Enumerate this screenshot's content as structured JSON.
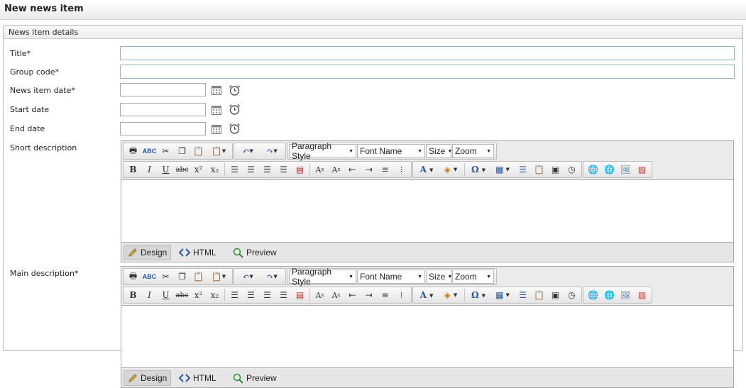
{
  "page": {
    "title": "New news item"
  },
  "section": {
    "legend": "News item details"
  },
  "fields": {
    "title": {
      "label": "Title*",
      "value": ""
    },
    "group_code": {
      "label": "Group code*",
      "value": ""
    },
    "news_item_date": {
      "label": "News item date*",
      "value": "",
      "calendar_icon": "calendar-icon",
      "time_icon": "alarm-clock-icon"
    },
    "start_date": {
      "label": "Start date",
      "value": "",
      "calendar_icon": "calendar-icon",
      "time_icon": "alarm-clock-icon"
    },
    "end_date": {
      "label": "End date",
      "value": "",
      "calendar_icon": "calendar-icon",
      "time_icon": "alarm-clock-icon"
    },
    "short_description": {
      "label": "Short description"
    },
    "main_description": {
      "label": "Main description*"
    }
  },
  "editor": {
    "toolbar_row1": {
      "group1_icons": [
        "print-icon",
        "spellcheck-icon",
        "cut-icon",
        "copy-icon",
        "paste-icon",
        "paste-options-icon"
      ],
      "group2_icons": [
        "undo-icon",
        "redo-icon"
      ],
      "paragraph_style": "Paragraph Style",
      "font_name": "Font Name",
      "size": "Size",
      "zoom": "Zoom"
    },
    "toolbar_row2": {
      "format_buttons": [
        "B",
        "I",
        "U",
        "abc",
        "x²",
        "x₂"
      ],
      "align_icons": [
        "align-left-icon",
        "align-center-icon",
        "align-right-icon",
        "justify-icon",
        "style-icon"
      ],
      "list_icons": [
        "superscript-a-icon",
        "subscript-a-icon",
        "outdent-icon",
        "indent-icon",
        "numbered-list-icon",
        "bulleted-list-icon"
      ],
      "color_labels": [
        "A",
        "◈",
        "Ω"
      ],
      "insert_icons": [
        "table-icon",
        "paragraph-icon",
        "clipboard-icon",
        "form-icon",
        "clock-icon"
      ],
      "link_icons": [
        "hyperlink-icon",
        "unlink-icon",
        "image-icon",
        "flash-icon"
      ]
    },
    "modes": {
      "design": "Design",
      "html": "HTML",
      "preview": "Preview"
    }
  },
  "colors": {
    "accent_border": "#8fb3c9",
    "toolbar_bg": "#ebebeb"
  }
}
